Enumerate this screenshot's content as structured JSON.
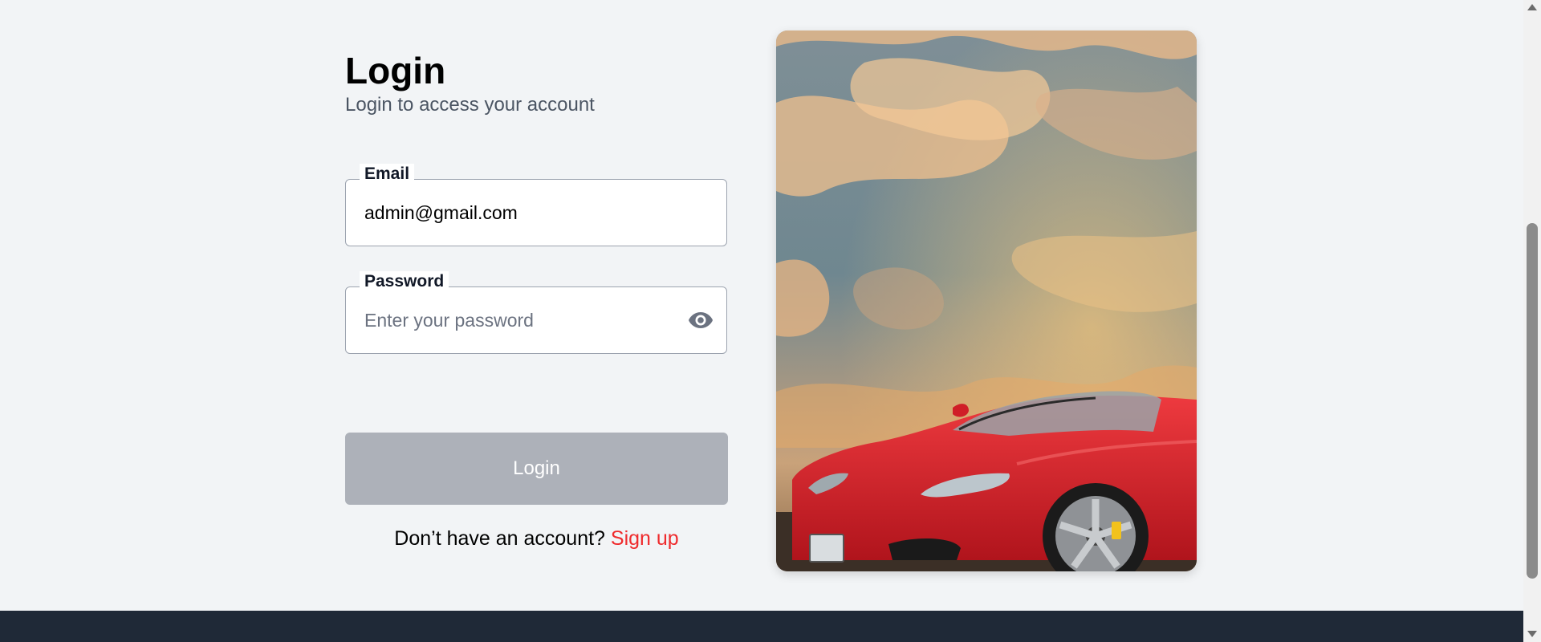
{
  "login": {
    "title": "Login",
    "subtitle": "Login to access your account",
    "email": {
      "label": "Email",
      "value": "admin@gmail.com",
      "placeholder": ""
    },
    "password": {
      "label": "Password",
      "value": "",
      "placeholder": "Enter your password",
      "toggle_icon": "eye-icon"
    },
    "submit_label": "Login",
    "signup_prompt": "Don’t have an account?",
    "signup_link": "Sign up"
  },
  "colors": {
    "background": "#f2f4f6",
    "footer": "#1f2937",
    "button_disabled": "#adb1b9",
    "link": "#ef2b2d",
    "car_red": "#d8202b"
  },
  "hero_image": {
    "subject": "red convertible sports car under a cloudy sunset sky"
  }
}
